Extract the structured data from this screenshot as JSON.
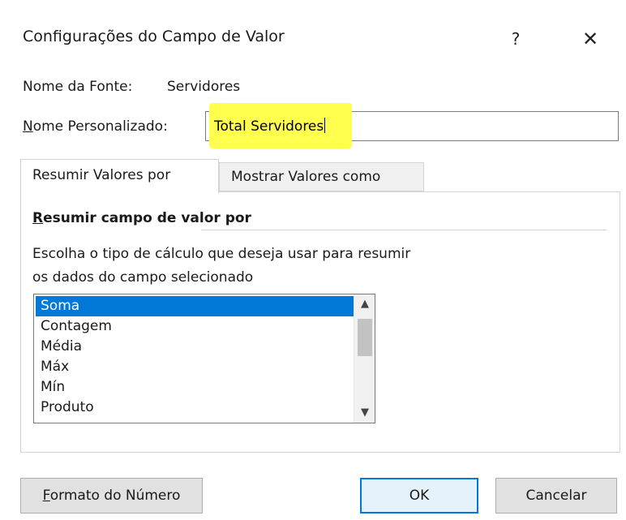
{
  "dialog": {
    "title": "Configurações do Campo de Valor",
    "help_label": "?",
    "close_label": "✕"
  },
  "source": {
    "label": "Nome da Fonte:",
    "value": "Servidores"
  },
  "custom_name": {
    "label_accel": "N",
    "label_rest": "ome Personalizado:",
    "value": "Total Servidores"
  },
  "tabs": [
    {
      "label": "Resumir Valores por",
      "active": true
    },
    {
      "label": "Mostrar Valores como",
      "active": false
    }
  ],
  "summarize": {
    "section_accel": "R",
    "section_rest": "esumir campo de valor por",
    "description_line1": "Escolha o tipo de cálculo que deseja usar para resumir",
    "description_line2": "os dados do campo selecionado",
    "options": [
      "Soma",
      "Contagem",
      "Média",
      "Máx",
      "Mín",
      "Produto"
    ],
    "selected": "Soma"
  },
  "buttons": {
    "number_format_accel": "F",
    "number_format_rest": "ormato do Número",
    "ok": "OK",
    "cancel": "Cancelar"
  },
  "colors": {
    "selection": "#0078d7",
    "highlight": "#ffff4d"
  }
}
